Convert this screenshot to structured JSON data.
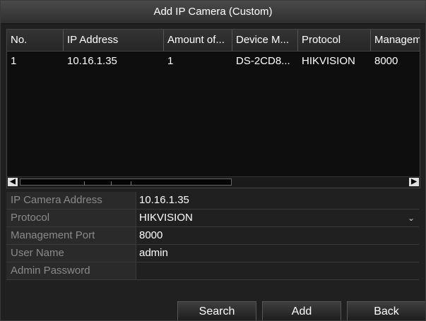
{
  "dialog": {
    "title": "Add IP Camera (Custom)"
  },
  "table": {
    "columns": [
      "No.",
      "IP Address",
      "Amount of...",
      "Device M...",
      "Protocol",
      "Managem"
    ],
    "rows": [
      [
        "1",
        "10.16.1.35",
        "1",
        "DS-2CD8...",
        "HIKVISION",
        "8000"
      ]
    ]
  },
  "form": {
    "ip_label": "IP Camera Address",
    "ip_value": "10.16.1.35",
    "protocol_label": "Protocol",
    "protocol_value": "HIKVISION",
    "port_label": "Management Port",
    "port_value": "8000",
    "user_label": "User Name",
    "user_value": "admin",
    "password_label": "Admin Password",
    "password_value": ""
  },
  "buttons": {
    "search": "Search",
    "add": "Add",
    "back": "Back"
  },
  "icons": {
    "scroll_left": "chevron-left-icon",
    "scroll_right": "chevron-right-icon",
    "dropdown": "chevron-down-icon"
  }
}
